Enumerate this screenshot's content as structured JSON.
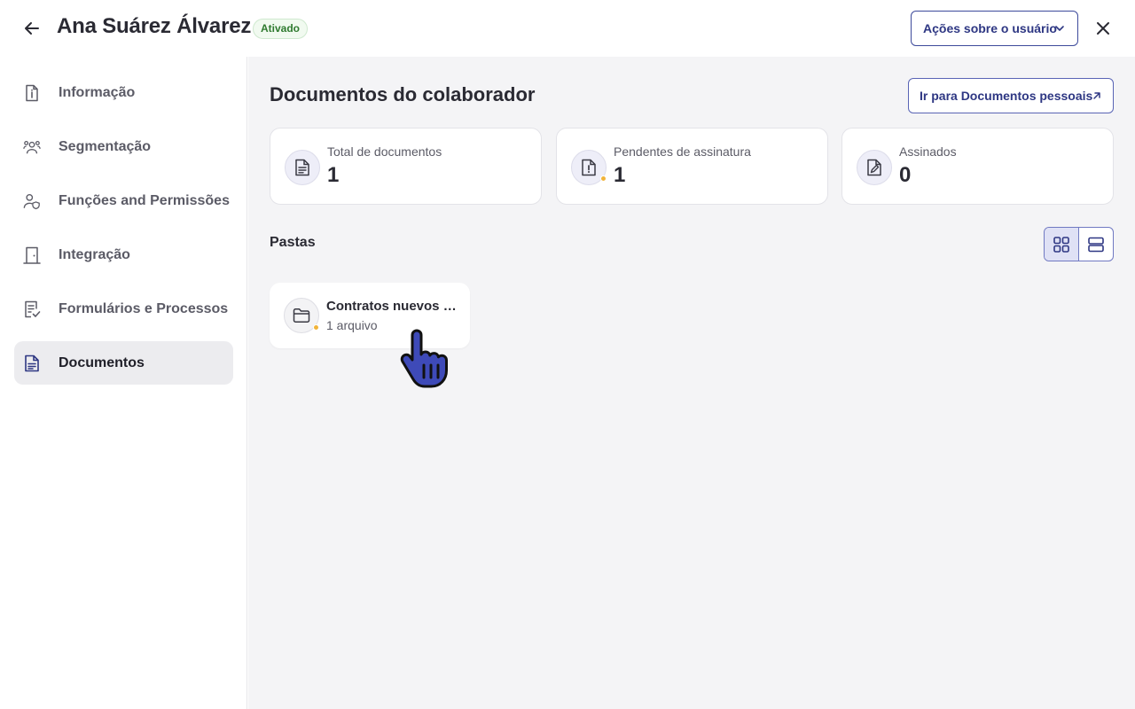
{
  "header": {
    "user_name": "Ana Suárez Álvarez",
    "status": "Ativado",
    "actions_label": "Ações sobre o usuário"
  },
  "sidebar": {
    "items": [
      {
        "label": "Informação",
        "icon": "info-file-icon",
        "active": false
      },
      {
        "label": "Segmentação",
        "icon": "users-group-icon",
        "active": false
      },
      {
        "label": "Funções and Permissões",
        "icon": "user-shield-icon",
        "active": false
      },
      {
        "label": "Integração",
        "icon": "door-icon",
        "active": false
      },
      {
        "label": "Formulários e Processos",
        "icon": "clipboard-check-icon",
        "active": false
      },
      {
        "label": "Documentos",
        "icon": "document-icon",
        "active": true
      }
    ]
  },
  "main": {
    "title": "Documentos do colaborador",
    "personal_docs_label": "Ir para Documentos pessoais",
    "stats": [
      {
        "label": "Total de documentos",
        "value": "1",
        "icon": "document-lines-icon"
      },
      {
        "label": "Pendentes de assinatura",
        "value": "1",
        "icon": "document-alert-icon"
      },
      {
        "label": "Assinados",
        "value": "0",
        "icon": "document-signed-icon"
      }
    ],
    "folders_title": "Pastas",
    "folders": [
      {
        "name": "Contratos nuevos ingresos",
        "count": "1 arquivo",
        "icon": "folder-icon"
      }
    ]
  },
  "colors": {
    "accent": "#2e3783",
    "status_green": "#2f7a2f",
    "pending_dot": "#f1b43a",
    "main_bg": "#f4f4f6"
  }
}
